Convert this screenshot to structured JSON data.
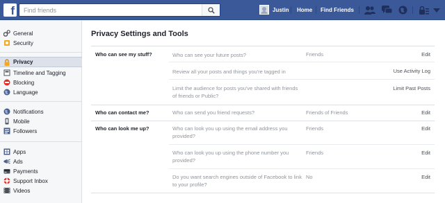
{
  "topbar": {
    "logo": "f",
    "search_placeholder": "Find friends",
    "user_name": "Justin",
    "home_label": "Home",
    "find_friends_label": "Find Friends",
    "icons": [
      "friend-requests-icon",
      "messages-icon",
      "notifications-icon",
      "privacy-shortcuts-icon",
      "account-menu-icon"
    ],
    "brand_color": "#3b5998"
  },
  "sidebar": {
    "groups": [
      [
        {
          "label": "General",
          "icon": "gears-icon"
        },
        {
          "label": "Security",
          "icon": "shield-icon"
        }
      ],
      [
        {
          "label": "Privacy",
          "icon": "lock-icon",
          "active": true
        },
        {
          "label": "Timeline and Tagging",
          "icon": "timeline-icon"
        },
        {
          "label": "Blocking",
          "icon": "blocking-icon"
        },
        {
          "label": "Language",
          "icon": "globe-icon"
        }
      ],
      [
        {
          "label": "Notifications",
          "icon": "globe-icon"
        },
        {
          "label": "Mobile",
          "icon": "mobile-icon"
        },
        {
          "label": "Followers",
          "icon": "followers-icon"
        }
      ],
      [
        {
          "label": "Apps",
          "icon": "apps-icon"
        },
        {
          "label": "Ads",
          "icon": "ads-icon"
        },
        {
          "label": "Payments",
          "icon": "payments-icon"
        },
        {
          "label": "Support Inbox",
          "icon": "support-icon"
        },
        {
          "label": "Videos",
          "icon": "videos-icon"
        }
      ]
    ]
  },
  "main": {
    "title": "Privacy Settings and Tools",
    "sections": [
      {
        "label": "Who can see my stuff?",
        "rows": [
          {
            "question": "Who can see your future posts?",
            "value": "Friends",
            "action": "Edit"
          },
          {
            "question": "Review all your posts and things you're tagged in",
            "value": "",
            "action": "Use Activity Log"
          },
          {
            "question": "Limit the audience for posts you've shared with friends of friends or Public?",
            "value": "",
            "action": "Limit Past Posts"
          }
        ]
      },
      {
        "label": "Who can contact me?",
        "rows": [
          {
            "question": "Who can send you friend requests?",
            "value": "Friends of Friends",
            "action": "Edit"
          }
        ]
      },
      {
        "label": "Who can look me up?",
        "rows": [
          {
            "question": "Who can look you up using the email address you provided?",
            "value": "Friends",
            "action": "Edit"
          },
          {
            "question": "Who can look you up using the phone number you provided?",
            "value": "Friends",
            "action": "Edit"
          },
          {
            "question": "Do you want search engines outside of Facebook to link to your profile?",
            "value": "No",
            "action": "Edit"
          }
        ]
      }
    ]
  }
}
